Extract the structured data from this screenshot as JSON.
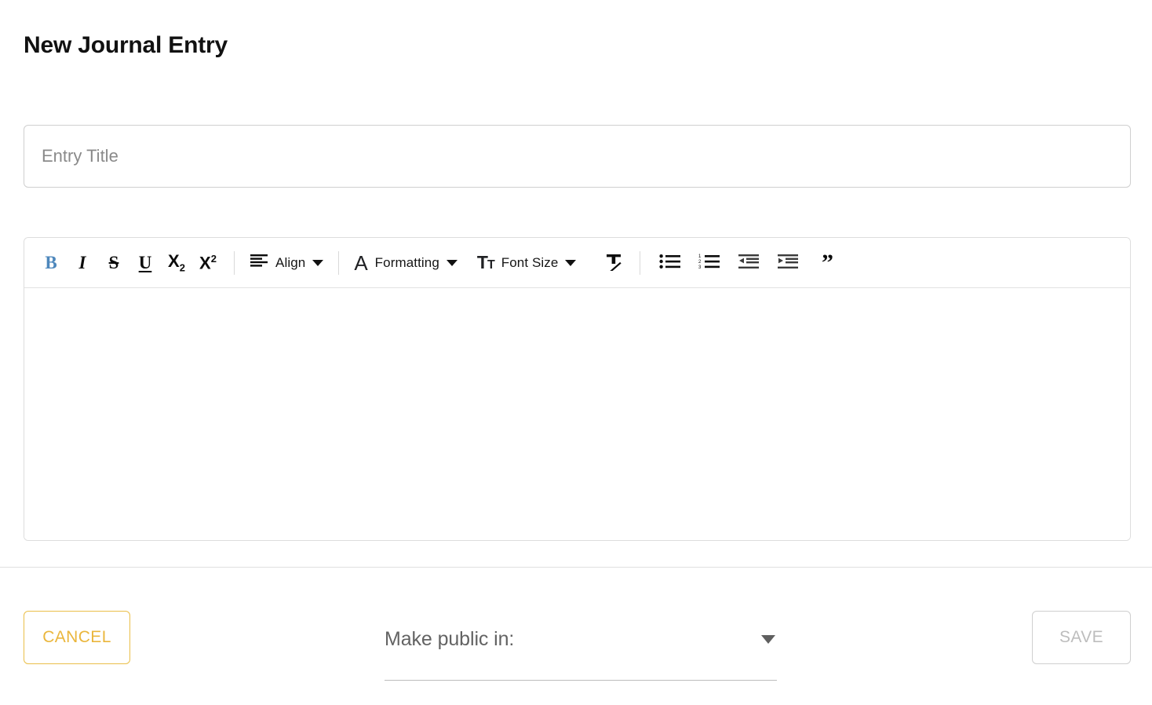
{
  "page": {
    "title": "New Journal Entry",
    "accent_yellow": "#eab63c",
    "accent_blue": "#4d87bc",
    "disabled_gray": "#bdbdbd"
  },
  "entry_title_field": {
    "value": "",
    "placeholder": "Entry Title",
    "name": "entry-title"
  },
  "editor": {
    "body_value": "",
    "body_placeholder": "",
    "toolbar": {
      "bold": {
        "label": "B",
        "icon": "bold-icon",
        "active": true
      },
      "italic": {
        "label": "I",
        "icon": "italic-icon",
        "active": false
      },
      "strikethrough": {
        "label": "S",
        "icon": "strikethrough-icon",
        "active": false
      },
      "underline": {
        "label": "U",
        "icon": "underline-icon",
        "active": false
      },
      "subscript": {
        "label": "X",
        "sub": "2",
        "icon": "subscript-icon",
        "active": false
      },
      "superscript": {
        "label": "X",
        "sup": "2",
        "icon": "superscript-icon",
        "active": false
      },
      "align": {
        "label": "Align",
        "icon": "align-left-icon",
        "caret": "chevron-down-icon"
      },
      "formatting": {
        "label": "Formatting",
        "icon": "font-A-icon",
        "caret": "chevron-down-icon"
      },
      "font_size": {
        "label": "Font Size",
        "icon": "font-size-icon",
        "icon_big": "T",
        "icon_small": "T",
        "caret": "chevron-down-icon"
      },
      "clear_formatting": {
        "label": "",
        "icon": "clear-formatting-icon"
      },
      "bullet_list": {
        "label": "",
        "icon": "bullet-list-icon"
      },
      "numbered_list": {
        "label": "",
        "icon": "numbered-list-icon",
        "numbers": [
          "1",
          "2",
          "3"
        ]
      },
      "outdent": {
        "label": "",
        "icon": "outdent-icon"
      },
      "indent": {
        "label": "",
        "icon": "indent-icon"
      },
      "blockquote": {
        "label": "”",
        "icon": "blockquote-icon"
      }
    }
  },
  "footer": {
    "cancel_label": "CANCEL",
    "save_label": "SAVE",
    "save_disabled": true,
    "visibility_select": {
      "label": "Make public in:",
      "value": "",
      "caret": "chevron-down-icon"
    }
  }
}
